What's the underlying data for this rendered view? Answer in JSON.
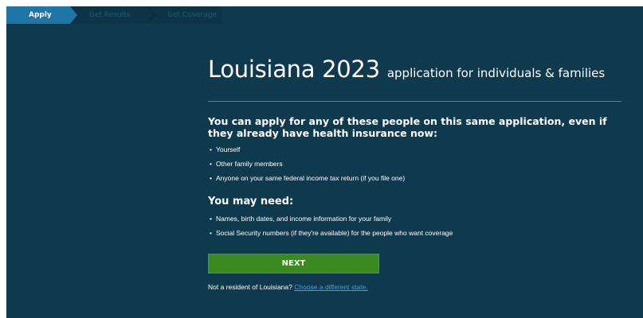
{
  "progress": {
    "steps": [
      {
        "label": "Apply",
        "state": "active"
      },
      {
        "label": "Get Results",
        "state": "inactive"
      },
      {
        "label": "Get Coverage",
        "state": "inactive"
      }
    ]
  },
  "header": {
    "title": "Louisiana 2023",
    "subtitle": "application for individuals & families"
  },
  "intro": {
    "heading": "You can apply for any of these people on this same application, even if they already have health insurance now:",
    "items": [
      "Yourself",
      "Other family members",
      "Anyone on your same federal income tax return (if you file one)"
    ]
  },
  "needs": {
    "heading": "You may need:",
    "items": [
      "Names, birth dates, and income information for your family",
      "Social Security numbers (if they're available) for the people who want coverage"
    ]
  },
  "actions": {
    "next_label": "NEXT"
  },
  "resident": {
    "prefix": "Not a resident of Louisiana?",
    "link": "Choose a different state."
  },
  "colors": {
    "background": "#0f3a4e",
    "active_step": "#1e75a8",
    "next_button": "#3a8a1f",
    "link": "#3ea2e0"
  }
}
